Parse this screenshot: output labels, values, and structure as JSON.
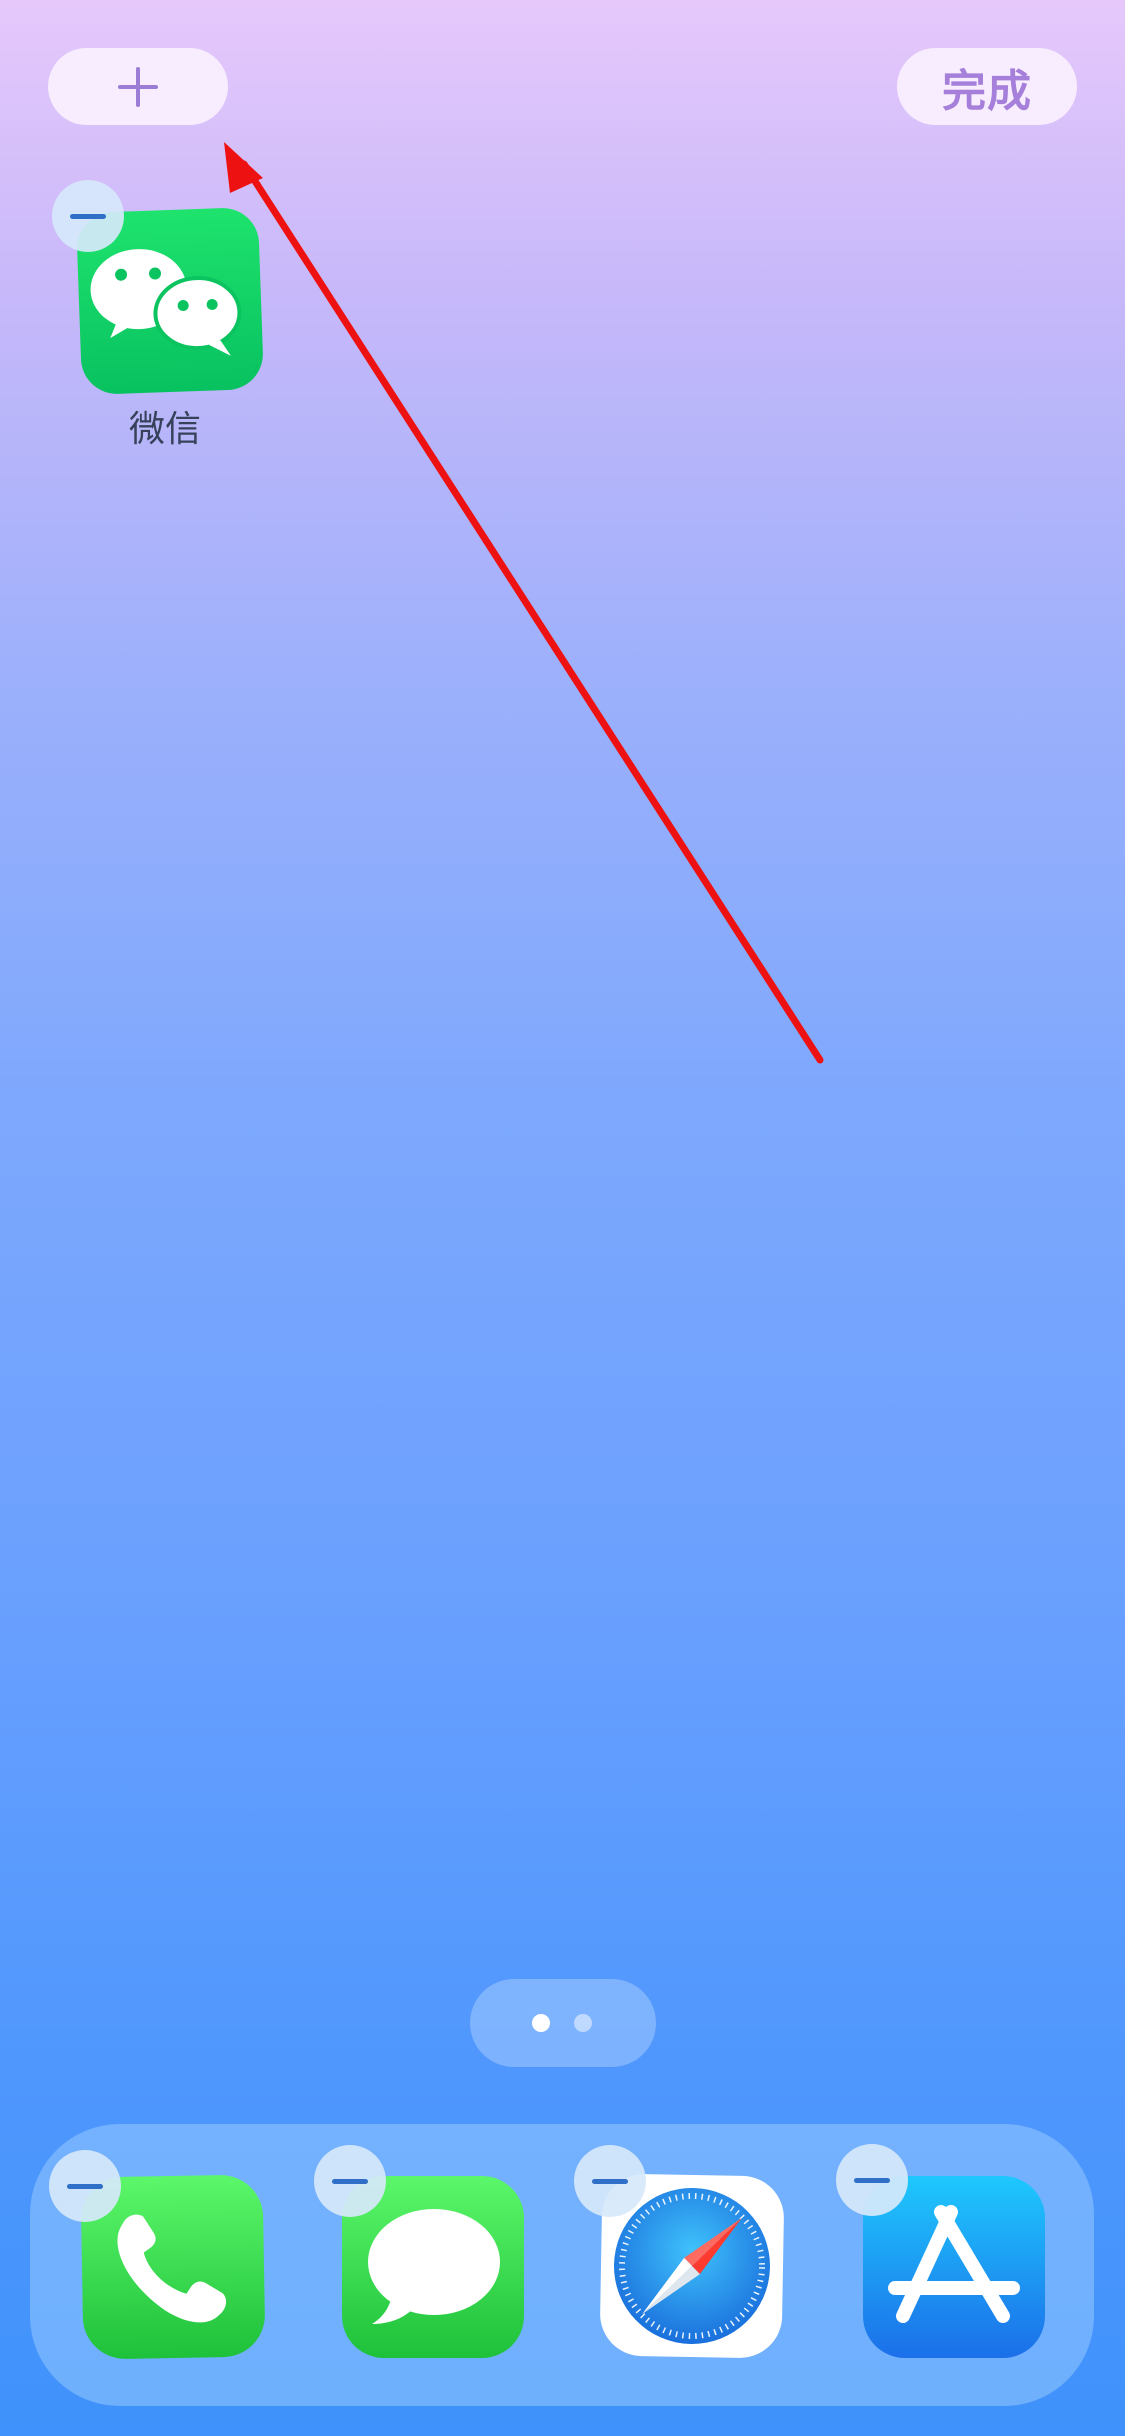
{
  "top_bar": {
    "add_button_icon": "plus-icon",
    "done_label": "完成"
  },
  "home": {
    "apps": [
      {
        "label": "微信",
        "icon": "wechat-icon"
      }
    ]
  },
  "page_indicator": {
    "pages": 2,
    "current_page": 1
  },
  "dock": {
    "apps": [
      {
        "icon": "phone-icon"
      },
      {
        "icon": "messages-icon"
      },
      {
        "icon": "safari-icon"
      },
      {
        "icon": "app-store-icon"
      }
    ]
  },
  "colors": {
    "accent_purple": "#a57fd9",
    "annotation_arrow": "#ee1111",
    "wechat_green": "#08c160"
  }
}
